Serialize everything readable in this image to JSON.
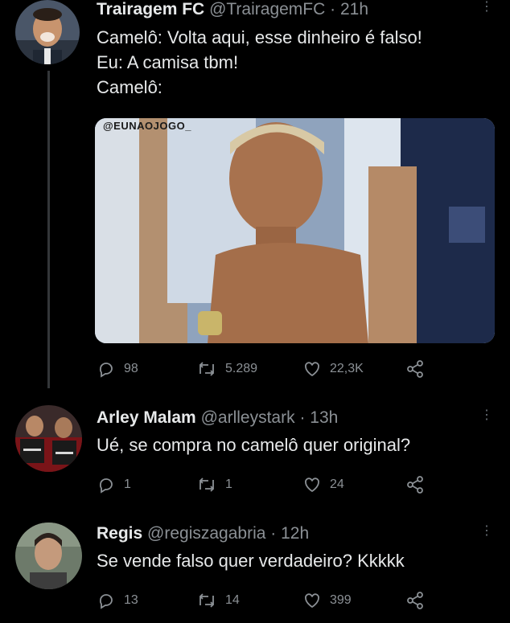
{
  "tweets": [
    {
      "name": "Trairagem FC",
      "handle": "@TrairagemFC",
      "sep": "·",
      "time": "21h",
      "lines": [
        "Camelô: Volta aqui, esse dinheiro é falso!",
        "Eu: A camisa tbm!",
        "Camelô:"
      ],
      "media_watermark": "@EUNAOJOGO_",
      "replies": "98",
      "retweets": "5.289",
      "likes": "22,3K"
    },
    {
      "name": "Arley Malam",
      "handle": "@arlleystark",
      "sep": "·",
      "time": "13h",
      "lines": [
        "Ué, se compra no camelô quer original?"
      ],
      "replies": "1",
      "retweets": "1",
      "likes": "24"
    },
    {
      "name": "Regis",
      "handle": "@regiszagabria",
      "sep": "·",
      "time": "12h",
      "lines": [
        "Se vende falso quer verdadeiro? Kkkkk"
      ],
      "replies": "13",
      "retweets": "14",
      "likes": "399"
    }
  ],
  "icons": {
    "reply": "reply-icon",
    "retweet": "retweet-icon",
    "like": "like-icon",
    "share": "share-icon",
    "more": "more-icon"
  },
  "colors": {
    "background": "#000000",
    "text": "#e7e9ea",
    "secondary": "#8b9095",
    "thread_line": "#333639"
  }
}
